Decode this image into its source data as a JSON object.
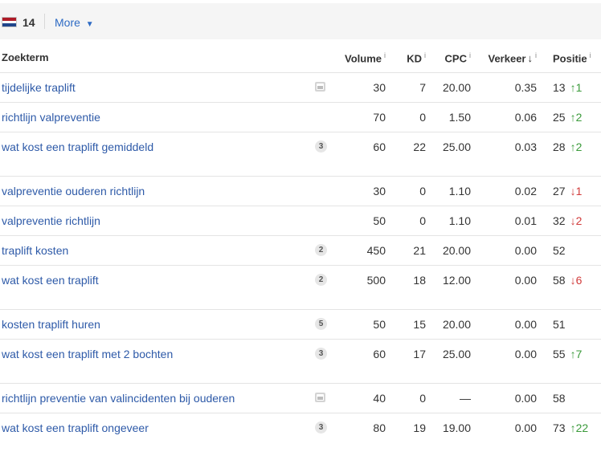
{
  "topbar": {
    "position_count": "14",
    "more_label": "More",
    "caret": "▼"
  },
  "header": {
    "keyword": "Zoekterm",
    "volume": "Volume",
    "kd": "KD",
    "cpc": "CPC",
    "traffic": "Verkeer",
    "traffic_sort_arrow": "↓",
    "position": "Positie",
    "info": "i"
  },
  "colors": {
    "link": "#2e5aa8",
    "up": "#3a9a3a",
    "down": "#d13b3b",
    "header_bg": "#f5f5f5"
  },
  "rows": [
    {
      "keyword": "tijdelijke traplift",
      "feature": "image-icon",
      "volume": "30",
      "kd": "7",
      "cpc": "20.00",
      "traffic": "0.35",
      "position": "13",
      "change": "↑1",
      "dir": "up"
    },
    {
      "keyword": "richtlijn valpreventie",
      "feature": "",
      "volume": "70",
      "kd": "0",
      "cpc": "1.50",
      "traffic": "0.06",
      "position": "25",
      "change": "↑2",
      "dir": "up"
    },
    {
      "keyword": "wat kost een traplift gemiddeld",
      "feature": "3",
      "volume": "60",
      "kd": "22",
      "cpc": "25.00",
      "traffic": "0.03",
      "position": "28",
      "change": "↑2",
      "dir": "up"
    },
    {
      "keyword": "valpreventie ouderen richtlijn",
      "feature": "",
      "volume": "30",
      "kd": "0",
      "cpc": "1.10",
      "traffic": "0.02",
      "position": "27",
      "change": "↓1",
      "dir": "down"
    },
    {
      "keyword": "valpreventie richtlijn",
      "feature": "",
      "volume": "50",
      "kd": "0",
      "cpc": "1.10",
      "traffic": "0.01",
      "position": "32",
      "change": "↓2",
      "dir": "down"
    },
    {
      "keyword": "traplift kosten",
      "feature": "2",
      "volume": "450",
      "kd": "21",
      "cpc": "20.00",
      "traffic": "0.00",
      "position": "52",
      "change": "",
      "dir": ""
    },
    {
      "keyword": "wat kost een traplift",
      "feature": "2",
      "volume": "500",
      "kd": "18",
      "cpc": "12.00",
      "traffic": "0.00",
      "position": "58",
      "change": "↓6",
      "dir": "down"
    },
    {
      "keyword": "kosten traplift huren",
      "feature": "5",
      "volume": "50",
      "kd": "15",
      "cpc": "20.00",
      "traffic": "0.00",
      "position": "51",
      "change": "",
      "dir": ""
    },
    {
      "keyword": "wat kost een traplift met 2 bochten",
      "feature": "3",
      "volume": "60",
      "kd": "17",
      "cpc": "25.00",
      "traffic": "0.00",
      "position": "55",
      "change": "↑7",
      "dir": "up"
    },
    {
      "keyword": "richtlijn preventie van valincidenten bij ouderen",
      "feature": "image-icon",
      "volume": "40",
      "kd": "0",
      "cpc": "—",
      "traffic": "0.00",
      "position": "58",
      "change": "",
      "dir": ""
    },
    {
      "keyword": "wat kost een traplift ongeveer",
      "feature": "3",
      "volume": "80",
      "kd": "19",
      "cpc": "19.00",
      "traffic": "0.00",
      "position": "73",
      "change": "↑22",
      "dir": "up"
    }
  ]
}
